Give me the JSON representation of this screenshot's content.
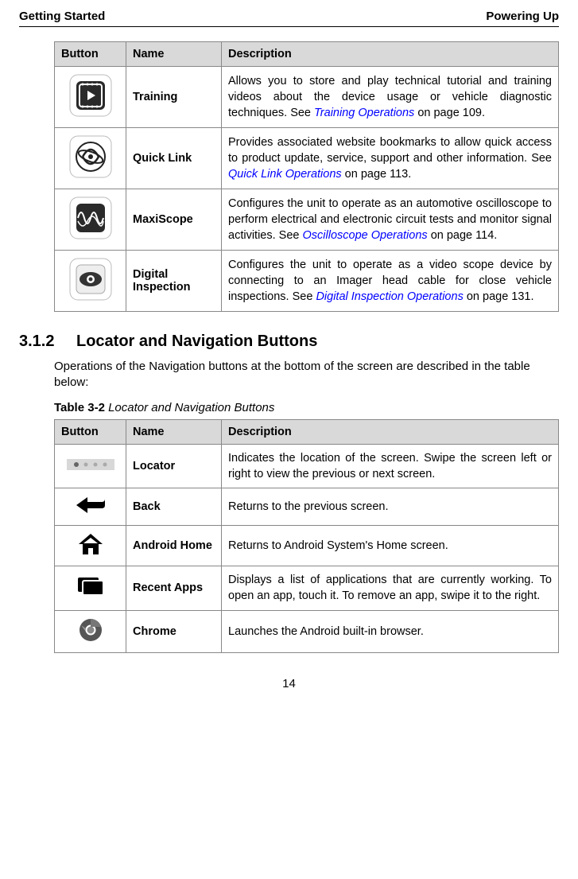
{
  "header": {
    "left": "Getting Started",
    "right": "Powering Up"
  },
  "table1": {
    "headers": {
      "button": "Button",
      "name": "Name",
      "desc": "Description"
    },
    "rows": [
      {
        "name": "Training",
        "desc_pre": "Allows you to store and play technical tutorial and training videos about the device usage or vehicle diagnostic techniques. See ",
        "desc_link": "Training Operations",
        "desc_post": " on page 109."
      },
      {
        "name": "Quick Link",
        "desc_pre": "Provides associated website bookmarks to allow quick access to product update, service, support and other information. See ",
        "desc_link": "Quick Link Operations",
        "desc_post": " on page 113."
      },
      {
        "name": "MaxiScope",
        "desc_pre": "Configures the unit to operate as an automotive oscilloscope to perform electrical and electronic circuit tests and monitor signal activities. See ",
        "desc_link": "Oscilloscope Operations",
        "desc_post": " on page 114."
      },
      {
        "name": "Digital Inspection",
        "desc_pre": "Configures the unit to operate as a video scope device by connecting to an Imager head cable for close vehicle inspections. See ",
        "desc_link": "Digital Inspection Operations",
        "desc_post": " on page 131."
      }
    ]
  },
  "section": {
    "num": "3.1.2",
    "title": "Locator and Navigation Buttons"
  },
  "para": "Operations of the Navigation buttons at the bottom of the screen are described in the table below:",
  "caption": {
    "bold": "Table 3-2",
    "ital": " Locator and Navigation Buttons"
  },
  "table2": {
    "headers": {
      "button": "Button",
      "name": "Name",
      "desc": "Description"
    },
    "rows": [
      {
        "name": "Locator",
        "desc": "Indicates the location of the screen. Swipe the screen left or right to view the previous or next screen."
      },
      {
        "name": "Back",
        "desc": "Returns to the previous screen."
      },
      {
        "name": "Android Home",
        "desc": "Returns to Android System's Home screen."
      },
      {
        "name": "Recent Apps",
        "desc": "Displays a list of applications that are currently working. To open an app, touch it. To remove an app, swipe it to the right."
      },
      {
        "name": "Chrome",
        "desc": "Launches the Android built-in browser."
      }
    ]
  },
  "page_num": "14"
}
